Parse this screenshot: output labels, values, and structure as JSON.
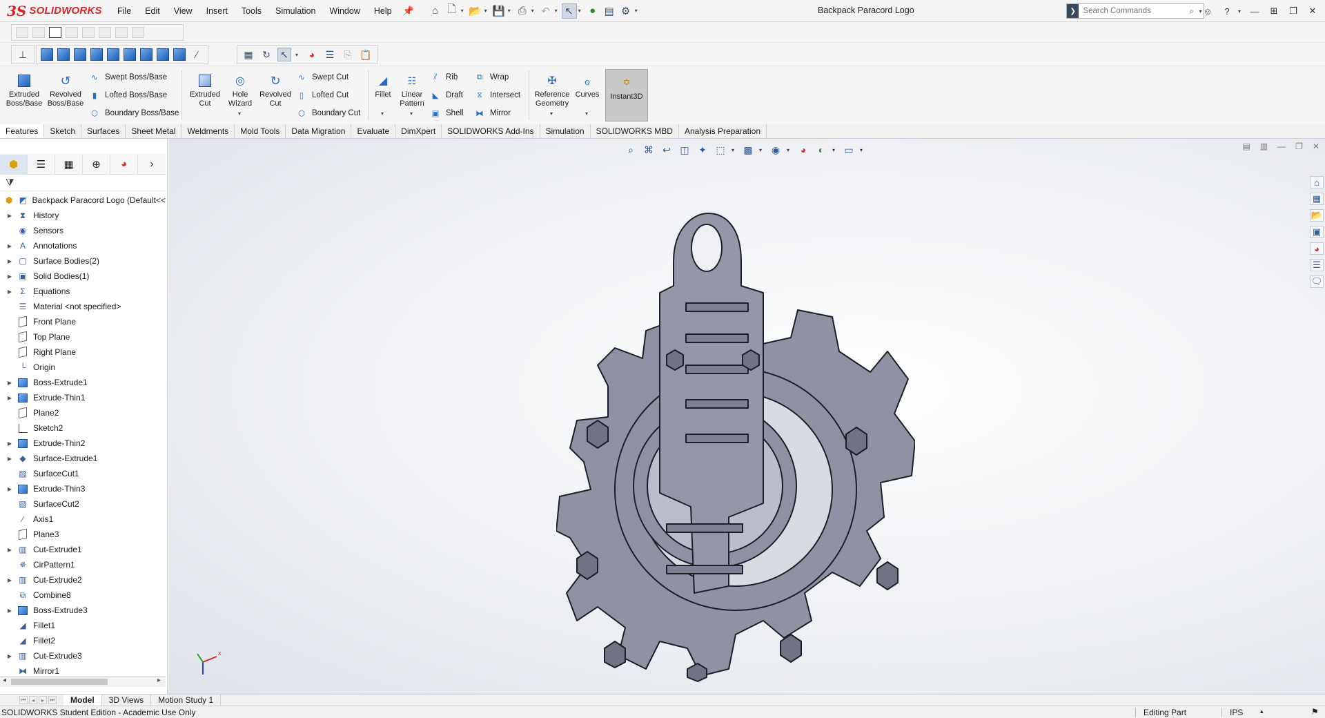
{
  "app": {
    "brand_ds": "3S",
    "brand_name": "SOLIDWORKS",
    "document_title": "Backpack Paracord Logo",
    "accent": "#d6252a"
  },
  "menu": [
    "File",
    "Edit",
    "View",
    "Insert",
    "Tools",
    "Simulation",
    "Window",
    "Help"
  ],
  "search": {
    "placeholder": "Search Commands"
  },
  "ribbon": {
    "extruded_boss": [
      "Extruded",
      "Boss/Base"
    ],
    "revolved_boss": [
      "Revolved",
      "Boss/Base"
    ],
    "swept_boss": "Swept Boss/Base",
    "lofted_boss": "Lofted Boss/Base",
    "boundary_boss": "Boundary Boss/Base",
    "extruded_cut": [
      "Extruded",
      "Cut"
    ],
    "hole_wizard": [
      "Hole",
      "Wizard"
    ],
    "revolved_cut": [
      "Revolved",
      "Cut"
    ],
    "swept_cut": "Swept Cut",
    "lofted_cut": "Lofted Cut",
    "boundary_cut": "Boundary Cut",
    "fillet": "Fillet",
    "linear_pattern": [
      "Linear",
      "Pattern"
    ],
    "rib": "Rib",
    "draft": "Draft",
    "shell": "Shell",
    "wrap": "Wrap",
    "intersect": "Intersect",
    "mirror": "Mirror",
    "reference_geometry": [
      "Reference",
      "Geometry"
    ],
    "curves": "Curves",
    "instant3d": "Instant3D"
  },
  "tabs": [
    "Features",
    "Sketch",
    "Surfaces",
    "Sheet Metal",
    "Weldments",
    "Mold Tools",
    "Data Migration",
    "Evaluate",
    "DimXpert",
    "SOLIDWORKS Add-Ins",
    "Simulation",
    "SOLIDWORKS MBD",
    "Analysis Preparation"
  ],
  "tree": {
    "root": "Backpack Paracord Logo  (Default<<",
    "items": [
      {
        "label": "History",
        "icon": "history-icon",
        "expandable": true
      },
      {
        "label": "Sensors",
        "icon": "sensor-icon",
        "expandable": false
      },
      {
        "label": "Annotations",
        "icon": "annotation-icon",
        "expandable": true
      },
      {
        "label": "Surface Bodies(2)",
        "icon": "surface-bodies-icon",
        "expandable": true
      },
      {
        "label": "Solid Bodies(1)",
        "icon": "solid-bodies-icon",
        "expandable": true
      },
      {
        "label": "Equations",
        "icon": "equations-icon",
        "expandable": true
      },
      {
        "label": "Material <not specified>",
        "icon": "material-icon",
        "expandable": false
      },
      {
        "label": "Front Plane",
        "icon": "plane-icon",
        "expandable": false
      },
      {
        "label": "Top Plane",
        "icon": "plane-icon",
        "expandable": false
      },
      {
        "label": "Right Plane",
        "icon": "plane-icon",
        "expandable": false
      },
      {
        "label": "Origin",
        "icon": "origin-icon",
        "expandable": false
      },
      {
        "label": "Boss-Extrude1",
        "icon": "extrude-icon",
        "expandable": true
      },
      {
        "label": "Extrude-Thin1",
        "icon": "extrude-icon",
        "expandable": true
      },
      {
        "label": "Plane2",
        "icon": "plane-icon",
        "expandable": false
      },
      {
        "label": "Sketch2",
        "icon": "sketch-icon",
        "expandable": false
      },
      {
        "label": "Extrude-Thin2",
        "icon": "extrude-icon",
        "expandable": true
      },
      {
        "label": "Surface-Extrude1",
        "icon": "surface-extrude-icon",
        "expandable": true
      },
      {
        "label": "SurfaceCut1",
        "icon": "surface-cut-icon",
        "expandable": false
      },
      {
        "label": "Extrude-Thin3",
        "icon": "extrude-icon",
        "expandable": true
      },
      {
        "label": "SurfaceCut2",
        "icon": "surface-cut-icon",
        "expandable": false
      },
      {
        "label": "Axis1",
        "icon": "axis-icon",
        "expandable": false
      },
      {
        "label": "Plane3",
        "icon": "plane-icon",
        "expandable": false
      },
      {
        "label": "Cut-Extrude1",
        "icon": "cut-extrude-icon",
        "expandable": true
      },
      {
        "label": "CirPattern1",
        "icon": "circular-pattern-icon",
        "expandable": false
      },
      {
        "label": "Cut-Extrude2",
        "icon": "cut-extrude-icon",
        "expandable": true
      },
      {
        "label": "Combine8",
        "icon": "combine-icon",
        "expandable": false
      },
      {
        "label": "Boss-Extrude3",
        "icon": "extrude-icon",
        "expandable": true
      },
      {
        "label": "Fillet1",
        "icon": "fillet-icon",
        "expandable": false
      },
      {
        "label": "Fillet2",
        "icon": "fillet-icon",
        "expandable": false
      },
      {
        "label": "Cut-Extrude3",
        "icon": "cut-extrude-icon",
        "expandable": true
      },
      {
        "label": "Mirror1",
        "icon": "mirror-icon",
        "expandable": false
      }
    ]
  },
  "bottom_tabs": [
    "Model",
    "3D Views",
    "Motion Study 1"
  ],
  "status": {
    "left": "SOLIDWORKS Student Edition - Academic Use Only",
    "mode": "Editing Part",
    "units": "IPS"
  },
  "model_color": "#8e92a3"
}
